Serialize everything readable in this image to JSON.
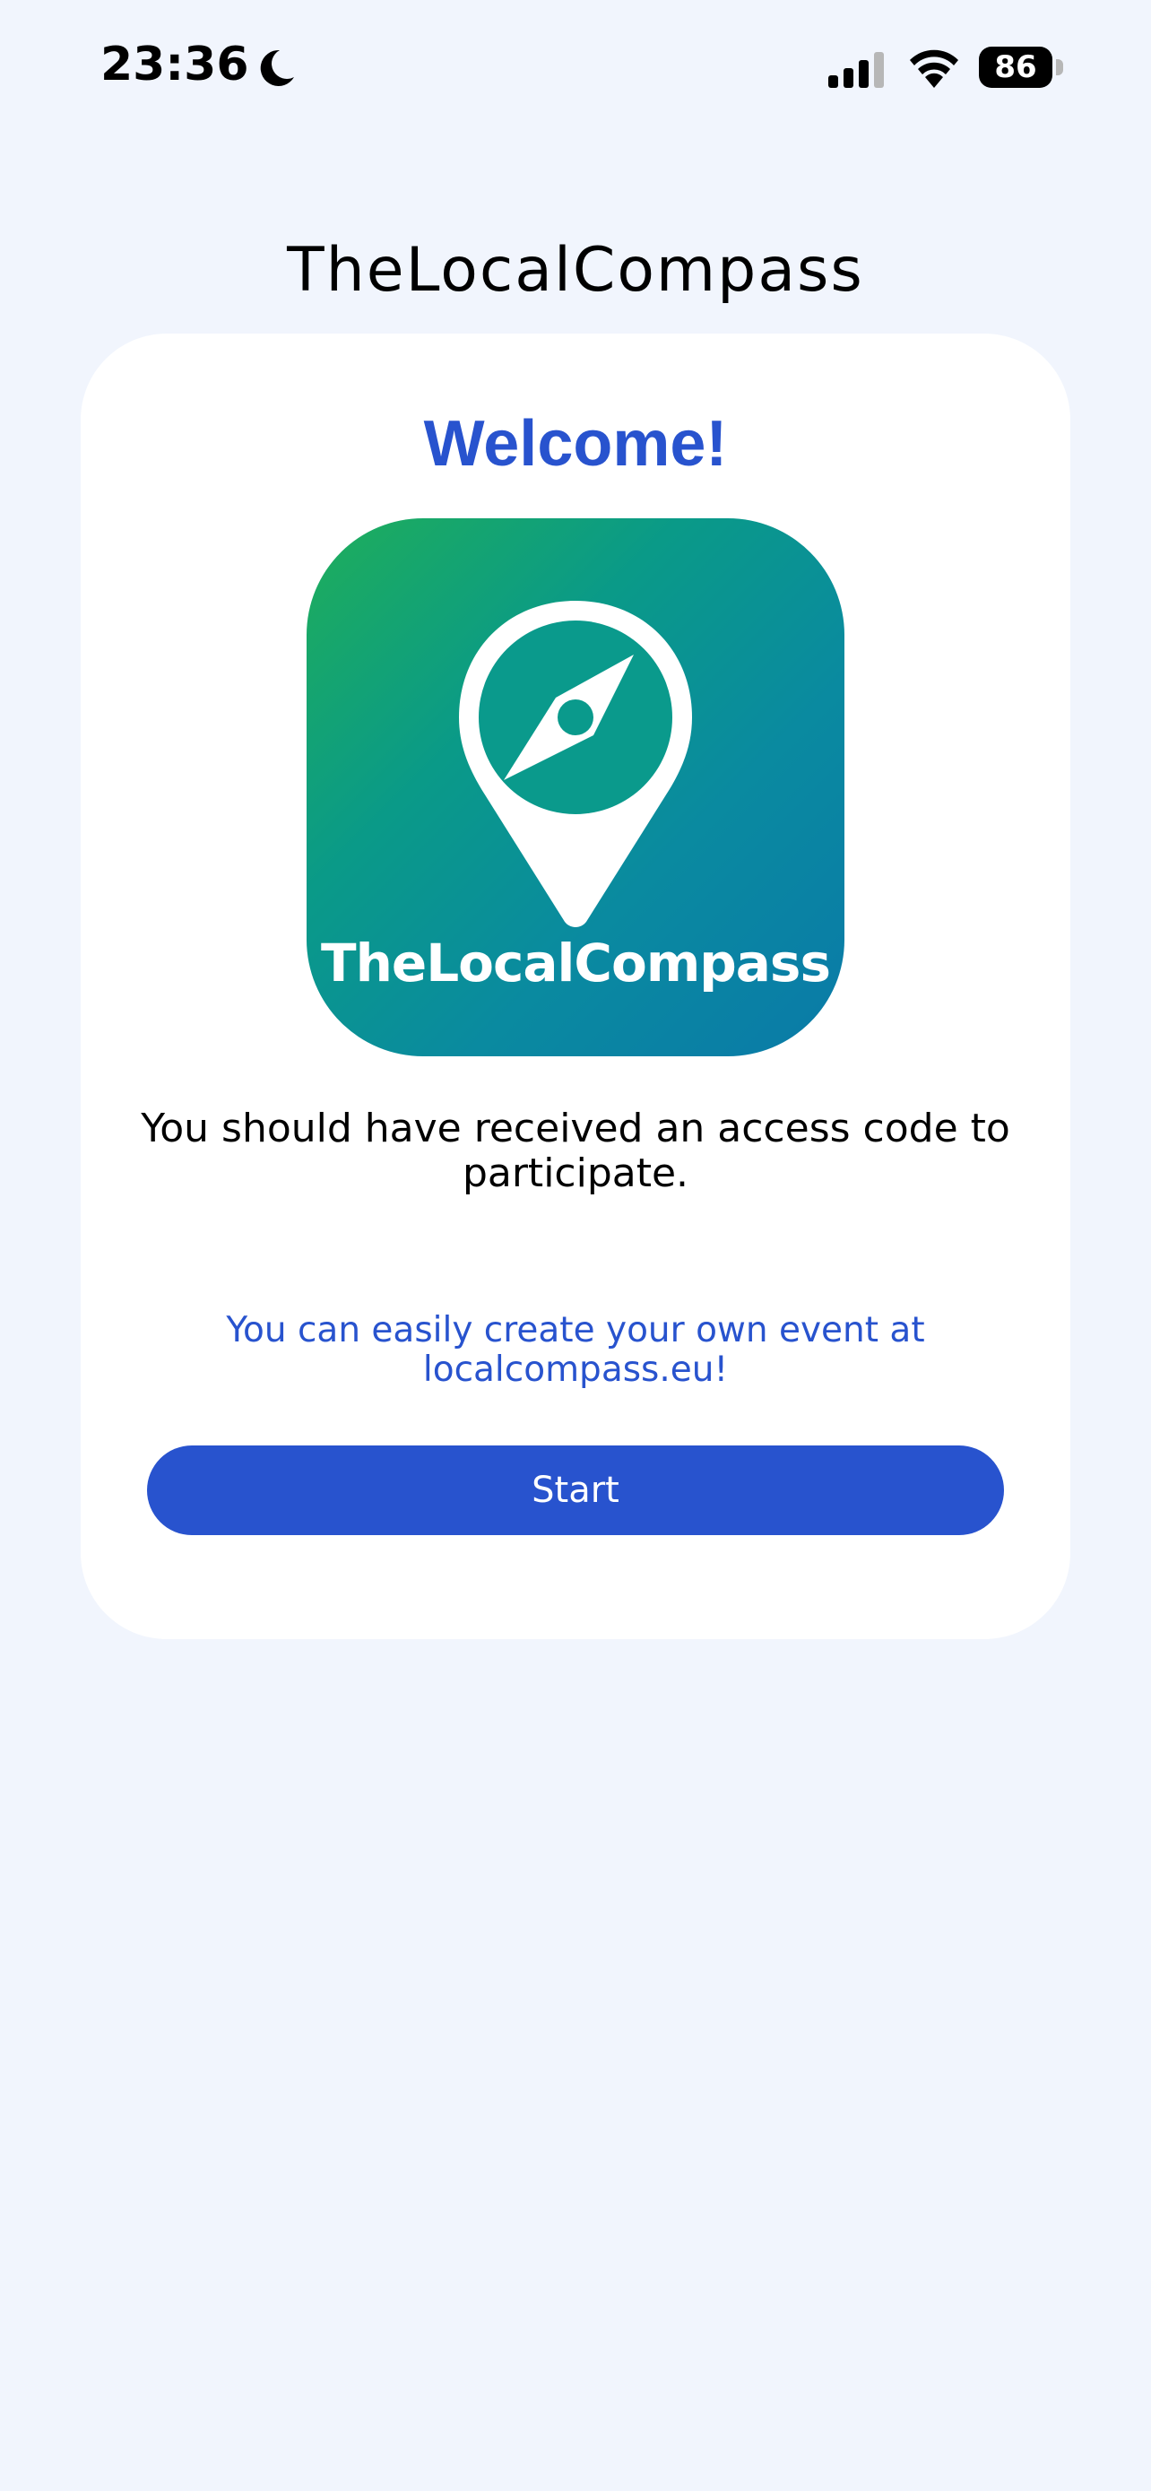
{
  "status_bar": {
    "time": "23:36",
    "battery": "86"
  },
  "app": {
    "title": "TheLocalCompass"
  },
  "card": {
    "welcome": "Welcome!",
    "logo_text": "TheLocalCompass",
    "message": "You should have received an access code to participate.",
    "link_text": "You can easily create your own event at localcompass.eu!",
    "start_label": "Start"
  },
  "colors": {
    "background": "#f1f5fd",
    "accent": "#2853ce",
    "card": "#ffffff"
  }
}
